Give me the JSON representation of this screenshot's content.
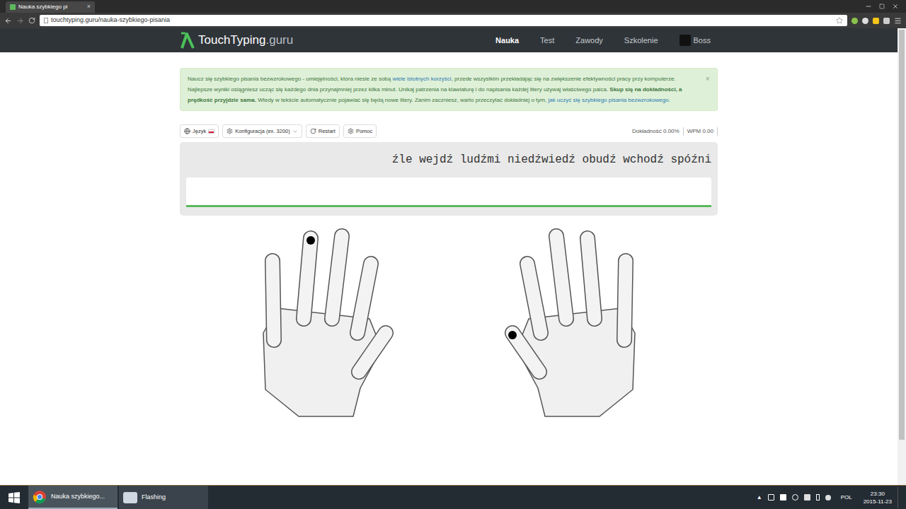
{
  "browser": {
    "tab_title": "Nauka szybkiego pi",
    "tab_close": "×",
    "url": "touchtyping.guru/nauka-szybkiego-pisania"
  },
  "site": {
    "logo_text": "TouchTyping",
    "logo_suffix": ".guru",
    "nav": [
      {
        "label": "Nauka",
        "selected": true
      },
      {
        "label": "Test",
        "selected": false
      },
      {
        "label": "Zawody",
        "selected": false
      },
      {
        "label": "Szkolenie",
        "selected": false
      },
      {
        "label": "Boss",
        "selected": false
      }
    ]
  },
  "alert": {
    "close": "×",
    "segments": [
      {
        "kind": "text",
        "text": "Naucz się szybkiego pisania bezwzrokowego - umiejętności, która niesie ze sobą "
      },
      {
        "kind": "link",
        "text": "wiele istotnych korzyści"
      },
      {
        "kind": "text",
        "text": ", przede wszystkim przekładając się na zwiększenie efektywności pracy przy komputerze. Najlepsze wyniki osiągniesz ucząc się każdego dnia przynajmniej przez kilka minut. Unikaj patrzenia na klawiaturę i do napisania każdej litery używaj właściwego palca. "
      },
      {
        "kind": "bold",
        "text": "Skup się na dokładności, a prędkość przyjdzie sama."
      },
      {
        "kind": "text",
        "text": " Wtedy w tekście automatycznie pojawiać się będą nowe litery. Zanim zaczniesz, warto przeczytać dokładniej o tym, "
      },
      {
        "kind": "link",
        "text": "jak uczyć się szybkiego pisania bezwzrokowego"
      },
      {
        "kind": "text",
        "text": "."
      }
    ]
  },
  "toolbar": {
    "buttons": [
      {
        "label": "Język",
        "kind": "language"
      },
      {
        "label": "Konfiguracja (ex. 3200)",
        "kind": "config"
      },
      {
        "label": "Restart",
        "kind": "restart"
      },
      {
        "label": "Pomoc",
        "kind": "help"
      }
    ],
    "stats": [
      "Dokładność 0.00%",
      "WPM 0.00"
    ]
  },
  "exercise": {
    "text": "źle wejdź ludźmi niedźwiedź obudź wchodź spóźni",
    "input": ""
  },
  "hands": {
    "left": {
      "pinky": false,
      "ring": true,
      "middle": false,
      "index": false,
      "thumb": false
    },
    "right": {
      "pinky": false,
      "ring": false,
      "middle": false,
      "index": false,
      "thumb": true
    }
  },
  "taskbar": {
    "apps": [
      {
        "label": "Nauka szybkiego...",
        "selected": true,
        "kind": "chrome"
      },
      {
        "label": "Flashing",
        "selected": false,
        "kind": "recorder"
      }
    ],
    "language": "POL",
    "time": "23:30",
    "date": "2015-11-23"
  }
}
